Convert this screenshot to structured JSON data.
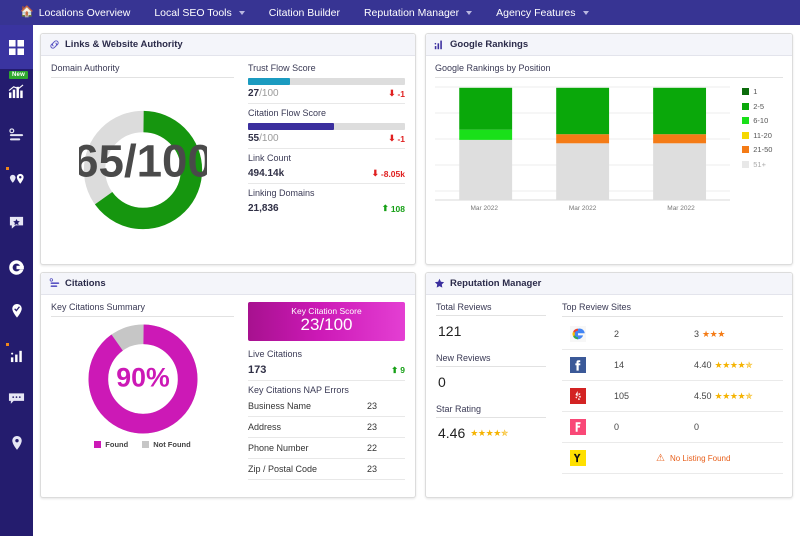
{
  "topnav": {
    "items": [
      {
        "label": "Locations Overview",
        "icon": "home-icon",
        "caret": false
      },
      {
        "label": "Local SEO Tools",
        "icon": "",
        "caret": true
      },
      {
        "label": "Citation Builder",
        "icon": "",
        "caret": false
      },
      {
        "label": "Reputation Manager",
        "icon": "",
        "caret": true
      },
      {
        "label": "Agency Features",
        "icon": "",
        "caret": true
      }
    ]
  },
  "sidebar": {
    "items": [
      {
        "name": "dashboard-grid-icon",
        "active": true,
        "badge": "",
        "dot": false
      },
      {
        "name": "rankings-chart-icon",
        "active": false,
        "badge": "New",
        "dot": false
      },
      {
        "name": "citations-route-icon",
        "active": false,
        "badge": "",
        "dot": false
      },
      {
        "name": "map-pins-icon",
        "active": false,
        "badge": "",
        "dot": true
      },
      {
        "name": "review-star-icon",
        "active": false,
        "badge": "",
        "dot": false
      },
      {
        "name": "google-g-icon",
        "active": false,
        "badge": "",
        "dot": false
      },
      {
        "name": "local-pin-check-icon",
        "active": false,
        "badge": "",
        "dot": false
      },
      {
        "name": "analytics-bars-icon",
        "active": false,
        "badge": "",
        "dot": true
      },
      {
        "name": "messages-icon",
        "active": false,
        "badge": "",
        "dot": false
      },
      {
        "name": "location-pin-icon",
        "active": false,
        "badge": "",
        "dot": false
      }
    ]
  },
  "links_panel": {
    "title": "Links & Website Authority",
    "icon": "link-chain-icon",
    "domain_authority": {
      "label": "Domain Authority",
      "value_text": "65/100",
      "value": 65,
      "max": 100,
      "color": "#16960f",
      "track_color": "#dcdcdc"
    },
    "metrics": [
      {
        "label": "Trust Flow Score",
        "value": "27",
        "denominator": "/100",
        "percent": 27,
        "bar_color": "#1b9bc0",
        "delta": "-1",
        "delta_dir": "down"
      },
      {
        "label": "Citation Flow Score",
        "value": "55",
        "denominator": "/100",
        "percent": 55,
        "bar_color": "#3b2f9e",
        "delta": "-1",
        "delta_dir": "down"
      }
    ],
    "counts": [
      {
        "label": "Link Count",
        "value": "494.14k",
        "delta": "-8.05k",
        "delta_dir": "down"
      },
      {
        "label": "Linking Domains",
        "value": "21,836",
        "delta": "108",
        "delta_dir": "up"
      }
    ]
  },
  "rankings_panel": {
    "title": "Google Rankings",
    "icon": "bar-chart-icon",
    "subtitle": "Google Rankings by Position"
  },
  "citations_panel": {
    "title": "Citations",
    "icon": "citations-icon",
    "summary_label": "Key Citations Summary",
    "donut": {
      "value_text": "90%",
      "found_percent": 90,
      "found_color": "#cc19b6",
      "notfound_color": "#c6c6c6",
      "legend": [
        {
          "label": "Found",
          "color": "#cc19b6"
        },
        {
          "label": "Not Found",
          "color": "#c6c6c6"
        }
      ]
    },
    "key_score": {
      "label": "Key Citation Score",
      "value": "23/100"
    },
    "live_citations": {
      "label": "Live Citations",
      "value": "173",
      "delta": "9",
      "delta_dir": "up"
    },
    "nap": {
      "label": "Key Citations NAP Errors",
      "rows": [
        {
          "label": "Business Name",
          "value": "23"
        },
        {
          "label": "Address",
          "value": "23"
        },
        {
          "label": "Phone Number",
          "value": "22"
        },
        {
          "label": "Zip / Postal Code",
          "value": "23"
        }
      ]
    }
  },
  "reputation_panel": {
    "title": "Reputation Manager",
    "icon": "star-icon",
    "metrics": [
      {
        "label": "Total Reviews",
        "value": "121",
        "stars": 0
      },
      {
        "label": "New Reviews",
        "value": "0",
        "stars": 0
      },
      {
        "label": "Star Rating",
        "value": "4.46",
        "stars": 4.5
      }
    ],
    "top_sites_label": "Top Review Sites",
    "sites": [
      {
        "icon": "google-icon",
        "count": "2",
        "rating": "3",
        "stars": 3,
        "no_listing": false
      },
      {
        "icon": "facebook-icon",
        "count": "14",
        "rating": "4.40",
        "stars": 4.5,
        "no_listing": false
      },
      {
        "icon": "yelp-icon",
        "count": "105",
        "rating": "4.50",
        "stars": 4.5,
        "no_listing": false
      },
      {
        "icon": "foursquare-icon",
        "count": "0",
        "rating": "0",
        "stars": 0,
        "no_listing": false
      },
      {
        "icon": "yellowpages-icon",
        "count": "",
        "rating": "",
        "stars": 0,
        "no_listing": true,
        "no_listing_text": "No Listing Found"
      }
    ]
  },
  "chart_data": {
    "type": "bar",
    "title": "Google Rankings by Position",
    "stacked": true,
    "categories": [
      "Mar 2022",
      "Mar 2022",
      "Mar 2022"
    ],
    "series": [
      {
        "name": "1",
        "color": "#0b6b0b",
        "values": [
          0,
          0,
          0
        ]
      },
      {
        "name": "2-5",
        "color": "#0aa80a",
        "values": [
          37,
          42,
          42
        ]
      },
      {
        "name": "6-10",
        "color": "#19e019",
        "values": [
          9,
          0,
          0
        ]
      },
      {
        "name": "11-20",
        "color": "#f5d800",
        "values": [
          0,
          0,
          0
        ]
      },
      {
        "name": "21-50",
        "color": "#f47b16",
        "values": [
          0,
          8,
          8
        ]
      },
      {
        "name": "51+",
        "color": "#dedede",
        "values": [
          54,
          50,
          50
        ]
      }
    ],
    "xlabel": "",
    "ylabel": "",
    "ylim": [
      0,
      100
    ],
    "grid": true,
    "legend_position": "right"
  }
}
